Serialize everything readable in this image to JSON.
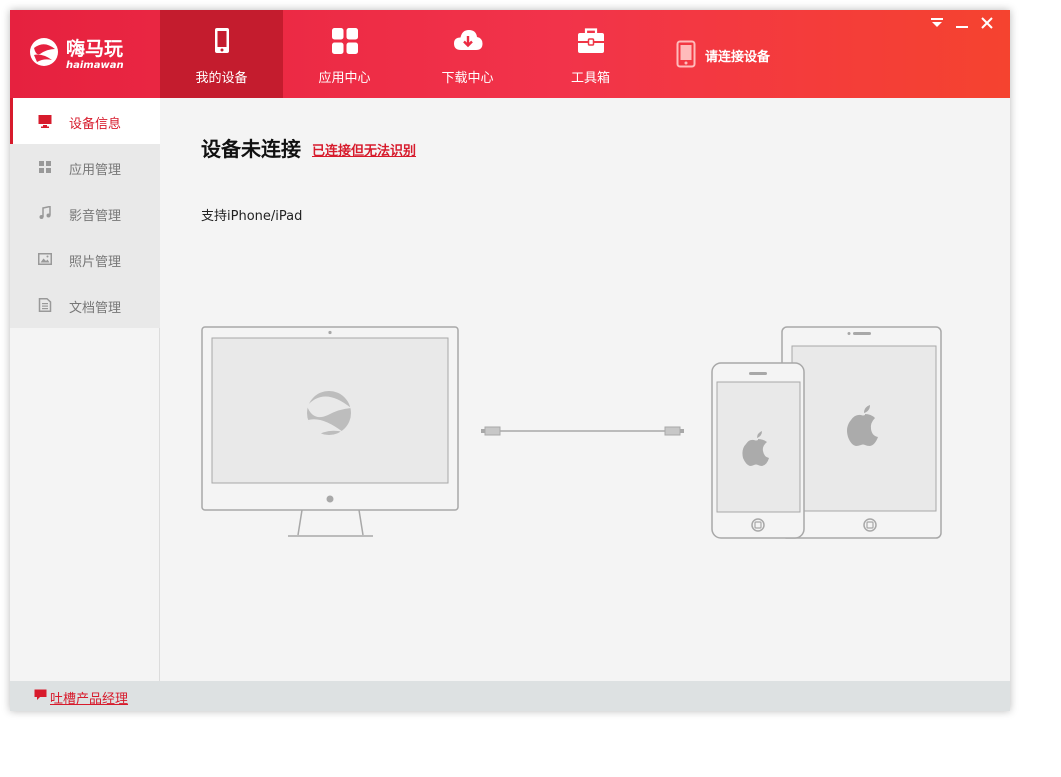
{
  "logo": {
    "text": "嗨马玩",
    "subtext": "haimawan"
  },
  "nav": {
    "items": [
      {
        "label": "我的设备",
        "icon": "phone-icon"
      },
      {
        "label": "应用中心",
        "icon": "grid-icon"
      },
      {
        "label": "下载中心",
        "icon": "cloud-download-icon"
      },
      {
        "label": "工具箱",
        "icon": "toolbox-icon"
      }
    ],
    "active_index": 0
  },
  "device_status": {
    "label": "请连接设备",
    "icon": "phone-icon"
  },
  "window_controls": [
    "menu-dropdown-icon",
    "minimize-icon",
    "close-icon"
  ],
  "sidebar": {
    "items": [
      {
        "label": "设备信息",
        "icon": "monitor-icon"
      },
      {
        "label": "应用管理",
        "icon": "grid-icon"
      },
      {
        "label": "影音管理",
        "icon": "music-icon"
      },
      {
        "label": "照片管理",
        "icon": "image-icon"
      },
      {
        "label": "文档管理",
        "icon": "document-icon"
      }
    ],
    "active_index": 0
  },
  "main": {
    "title": "设备未连接",
    "link": "已连接但无法识别",
    "support_text": "支持iPhone/iPad"
  },
  "footer": {
    "feedback_link": "吐槽产品经理",
    "icon": "speech-bubble-icon"
  },
  "colors": {
    "brand_red": "#e6213f",
    "active_nav": "#c41c2e",
    "accent": "#d71b2c",
    "content_bg": "#f4f4f4"
  }
}
